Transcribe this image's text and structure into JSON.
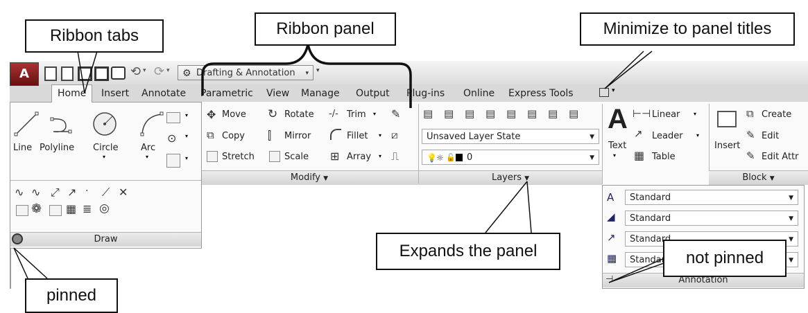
{
  "callouts": {
    "ribbon_tabs": "Ribbon tabs",
    "ribbon_panel": "Ribbon panel",
    "minimize": "Minimize to panel titles",
    "expands": "Expands the panel",
    "not_pinned": "not pinned",
    "pinned": "pinned"
  },
  "qat": {
    "workspace": "Drafting & Annotation"
  },
  "tabs": [
    "Home",
    "Insert",
    "Annotate",
    "Parametric",
    "View",
    "Manage",
    "Output",
    "Plug-ins",
    "Online",
    "Express Tools"
  ],
  "draw": {
    "title": "Draw",
    "tools": [
      "Line",
      "Polyline",
      "Circle",
      "Arc"
    ]
  },
  "modify": {
    "title": "Modify",
    "col1": [
      "Move",
      "Copy",
      "Stretch"
    ],
    "col2": [
      "Rotate",
      "Mirror",
      "Scale"
    ],
    "col3": [
      "Trim",
      "Fillet",
      "Array"
    ]
  },
  "layers": {
    "title": "Layers",
    "state": "Unsaved Layer State",
    "current": "0"
  },
  "annotation": {
    "text_label": "Text",
    "linear": "Linear",
    "leader": "Leader",
    "table": "Table",
    "title": "Annotation",
    "styles": [
      "Standard",
      "Standard",
      "Standard",
      "Standard"
    ]
  },
  "block": {
    "insert": "Insert",
    "create": "Create",
    "edit": "Edit",
    "edit_attr": "Edit Attr",
    "title": "Block"
  }
}
